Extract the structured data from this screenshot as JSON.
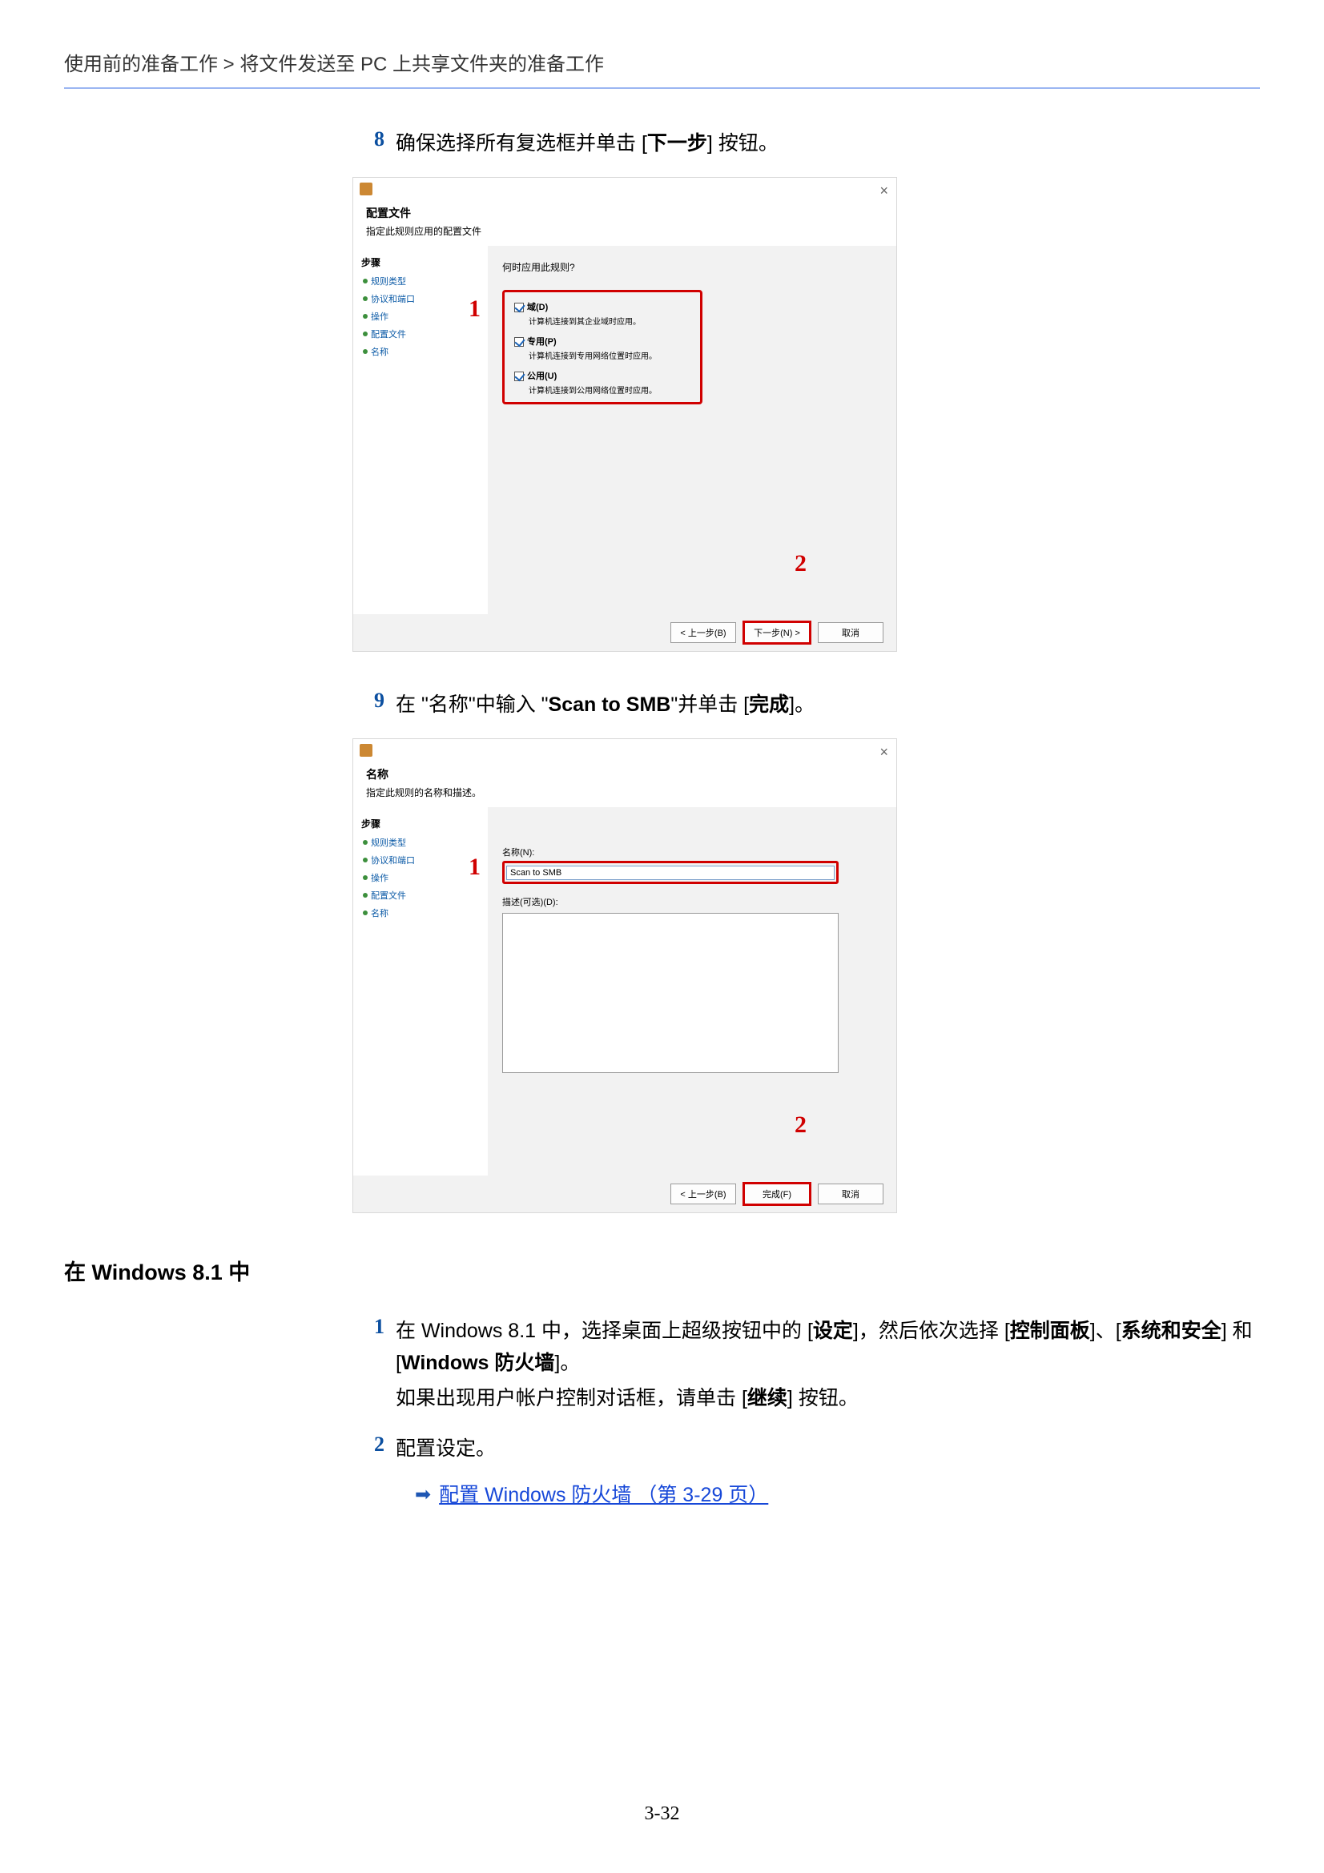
{
  "breadcrumb": "使用前的准备工作 > 将文件发送至 PC 上共享文件夹的准备工作",
  "step8": {
    "num": "8",
    "text_pre": "确保选择所有复选框并单击 [",
    "text_bold": "下一步",
    "text_post": "] 按钮。"
  },
  "dlg1": {
    "title": "配置文件",
    "subtitle": "指定此规则应用的配置文件",
    "side_head": "步骤",
    "side_items": [
      "规则类型",
      "协议和端口",
      "操作",
      "配置文件",
      "名称"
    ],
    "prompt": "何时应用此规则?",
    "callout1": "1",
    "chk": [
      {
        "label": "域(D)",
        "desc": "计算机连接到其企业域时应用。"
      },
      {
        "label": "专用(P)",
        "desc": "计算机连接到专用网络位置时应用。"
      },
      {
        "label": "公用(U)",
        "desc": "计算机连接到公用网络位置时应用。"
      }
    ],
    "callout2": "2",
    "btn_back": "< 上一步(B)",
    "btn_next": "下一步(N) >",
    "btn_cancel": "取消"
  },
  "step9": {
    "num": "9",
    "text": "在 \"名称\"中输入 \"",
    "bold": "Scan to SMB",
    "text2": "\"并单击 [",
    "bold2": "完成",
    "text3": "]。"
  },
  "dlg2": {
    "title": "名称",
    "subtitle": "指定此规则的名称和描述。",
    "side_head": "步骤",
    "side_items": [
      "规则类型",
      "协议和端口",
      "操作",
      "配置文件",
      "名称"
    ],
    "callout1": "1",
    "name_label": "名称(N):",
    "name_value": "Scan to SMB",
    "desc_label": "描述(可选)(D):",
    "callout2": "2",
    "btn_back": "< 上一步(B)",
    "btn_finish": "完成(F)",
    "btn_cancel": "取消"
  },
  "section": "在 Windows 8.1 中",
  "w81": {
    "s1num": "1",
    "s1_a": "在 Windows 8.1 中，选择桌面上超级按钮中的 [",
    "s1_b1": "设定",
    "s1_c": "]，然后依次选择 [",
    "s1_b2": "控制面板",
    "s1_d": "]、[",
    "s1_b3": "系统和安全",
    "s1_e": "] 和 [",
    "s1_b4": "Windows 防火墙",
    "s1_f": "]。",
    "s1_line2_a": "如果出现用户帐户控制对话框，请单击 [",
    "s1_line2_b": "继续",
    "s1_line2_c": "] 按钮。",
    "s2num": "2",
    "s2text": "配置设定。",
    "link": "配置 Windows 防火墙 （第 3-29 页）"
  },
  "page_num": "3-32"
}
